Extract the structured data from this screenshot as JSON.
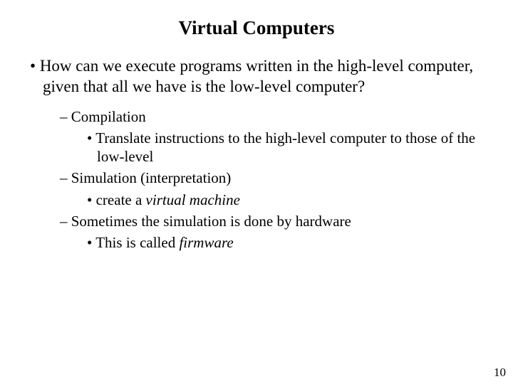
{
  "title": "Virtual Computers",
  "main_bullet": "How can we execute programs written in the high-level computer, given that all we have is the low-level computer?",
  "sub": [
    {
      "text": "Compilation",
      "children": [
        "Translate instructions to the high-level computer to those of the low-level"
      ]
    },
    {
      "text": "Simulation (interpretation)",
      "children_prefix": "create a ",
      "children_italic": "virtual machine"
    },
    {
      "text": "Sometimes the simulation is done by hardware",
      "children_prefix": "This is called ",
      "children_italic": "firmware"
    }
  ],
  "page_number": "10"
}
